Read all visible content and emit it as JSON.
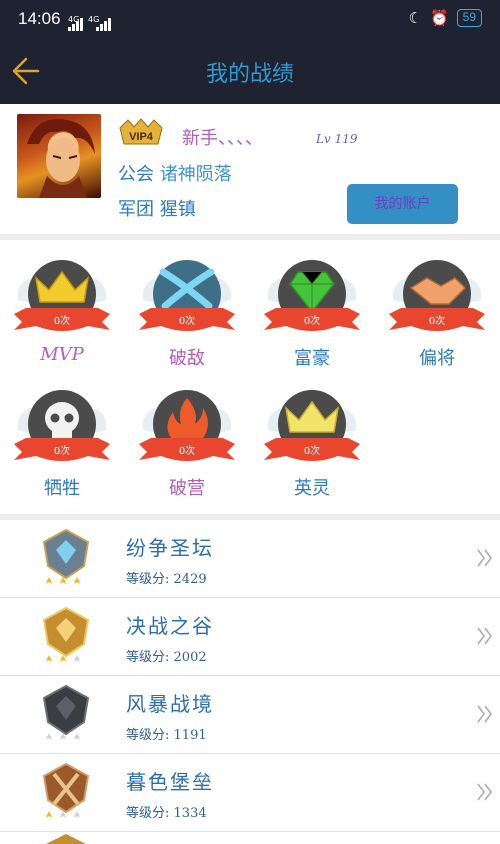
{
  "status_bar": {
    "time": "14:06",
    "signal_1": "4G",
    "signal_2": "4G",
    "battery": "59"
  },
  "header": {
    "title": "我的战绩",
    "back_icon": "back-arrow-icon"
  },
  "profile": {
    "vip": "VIP4",
    "nickname": "新手、、、、",
    "level": "Lv 119",
    "guild_label": "公会",
    "guild_value": "诸神陨落",
    "corps_label": "军团",
    "corps_value": "猩镇",
    "account_button": "我的账户"
  },
  "badges": [
    {
      "label": "MVP",
      "ribbon": "0次",
      "icon": "crown-icon",
      "label_color": "#b55bb8"
    },
    {
      "label": "破敌",
      "ribbon": "0次",
      "icon": "crossed-swords-icon",
      "label_color": "#b55bb8"
    },
    {
      "label": "富豪",
      "ribbon": "0次",
      "icon": "diamond-icon",
      "label_color": "#2c7bbf"
    },
    {
      "label": "偏将",
      "ribbon": "0次",
      "icon": "handshake-icon",
      "label_color": "#2c7bbf"
    },
    {
      "label": "牺牲",
      "ribbon": "0次",
      "icon": "skull-icon",
      "label_color": "#2c7bbf"
    },
    {
      "label": "破营",
      "ribbon": "0次",
      "icon": "flame-icon",
      "label_color": "#b55bb8"
    },
    {
      "label": "英灵",
      "ribbon": "0次",
      "icon": "crown-icon",
      "label_color": "#2c7bbf"
    }
  ],
  "ranks": [
    {
      "name": "纷争圣坛",
      "score_label": "等级分:",
      "score": "2429",
      "stars": 3,
      "tier": "diamond"
    },
    {
      "name": "决战之谷",
      "score_label": "等级分:",
      "score": "2002",
      "stars": 2,
      "tier": "gold"
    },
    {
      "name": "风暴战境",
      "score_label": "等级分:",
      "score": "1191",
      "stars": 0,
      "tier": "iron"
    },
    {
      "name": "暮色堡垒",
      "score_label": "等级分:",
      "score": "1334",
      "stars": 1,
      "tier": "bronze"
    }
  ],
  "colors": {
    "header_bg": "#1f2230",
    "accent_blue": "#2e9bd6",
    "button_bg": "#3490c4",
    "ribbon_red": "#e8462f"
  }
}
